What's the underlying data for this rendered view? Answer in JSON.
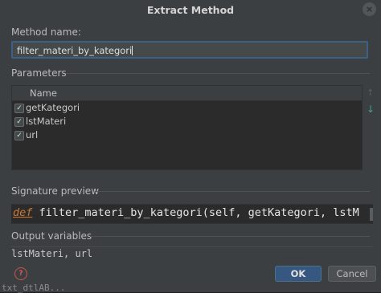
{
  "dialog": {
    "title": "Extract Method",
    "close_glyph": "×"
  },
  "method_name": {
    "label": "Method name:",
    "value": "filter_materi_by_kategori"
  },
  "parameters": {
    "section_label": "Parameters",
    "column_header": "Name",
    "rows": [
      {
        "name": "getKategori",
        "checked": true
      },
      {
        "name": "lstMateri",
        "checked": true
      },
      {
        "name": "url",
        "checked": true
      }
    ],
    "move_up_glyph": "↑",
    "move_down_glyph": "↓"
  },
  "signature_preview": {
    "section_label": "Signature preview",
    "keyword": "def",
    "text": " filter_materi_by_kategori(self, getKategori, lstM"
  },
  "output_variables": {
    "section_label": "Output variables",
    "value": "lstMateri, url"
  },
  "buttons": {
    "help_glyph": "?",
    "ok_label": "OK",
    "cancel_label": "Cancel"
  },
  "background_code": "txt_dtlAB...",
  "colors": {
    "accent": "#365880",
    "dialog_bg": "#3c3f41",
    "keyword": "#cc7832",
    "help_red": "#c75450"
  }
}
